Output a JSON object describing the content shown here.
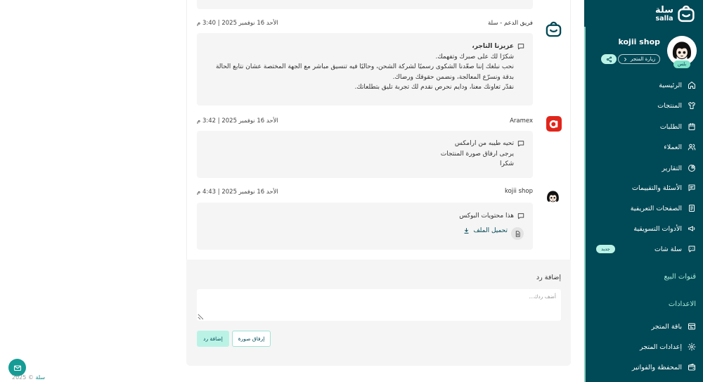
{
  "colors": {
    "primary": "#004956",
    "mint": "#BAF3E6",
    "bubble": "#F5F5F5",
    "aramex": "#E1251B",
    "fab": "#159C95",
    "link": "#0E8A85",
    "plan": "#7EE2C8"
  },
  "sidebar": {
    "logo": {
      "ar": "سلة",
      "en": "salla"
    },
    "store": {
      "name": "kojii shop",
      "plan_badge": "بلس",
      "visit_label": "زيارة المتجر"
    },
    "nav_items": [
      {
        "label": "الرئيسية",
        "icon": "home-icon"
      },
      {
        "label": "المنتجات",
        "icon": "shirt-icon"
      },
      {
        "label": "الطلبات",
        "icon": "orders-icon"
      },
      {
        "label": "العملاء",
        "icon": "users-icon"
      },
      {
        "label": "التقارير",
        "icon": "pie-chart-icon"
      },
      {
        "label": "الأسئلة والتقييمات",
        "icon": "message-square-icon"
      },
      {
        "label": "الصفحات التعريفية",
        "icon": "document-icon"
      },
      {
        "label": "الأدوات التسويقية",
        "icon": "megaphone-icon"
      },
      {
        "label": "سلة شات",
        "icon": "chat-icon",
        "badge": "جديد"
      }
    ],
    "sales_channels_label": "قنوات البيع",
    "settings_label": "الاعدادات",
    "settings_items": [
      {
        "label": "باقة المتجر",
        "icon": "store-plan-icon"
      },
      {
        "label": "إعدادات المتجر",
        "icon": "gear-icon"
      },
      {
        "label": "المحفظة والفواتير",
        "icon": "wallet-icon"
      }
    ]
  },
  "messages": [
    {
      "author": "فريق الدعم - سلة",
      "date": "الأحد 16 نوفمبر 2025 | 3:40 م",
      "greeting": "عزيزنا التاجر،",
      "lines": [
        "شكرًا لك على صبرك وتفهمك.",
        "نحب نبلغك إننا صعّدنا الشكوى رسميًا لشركة الشحن، وحاليًا فيه تنسيق مباشر مع الجهة المختصة عشان نتابع الحالة",
        "بدقة ونسرّع المعالجة، ونضمن حقوقك ورضاك.",
        "نقدّر تعاونك معنا، ودايم نحرص نقدم لك تجربة تليق بتطلعاتك."
      ]
    },
    {
      "author": "Aramex",
      "date": "الأحد 16 نوفمبر 2025 | 3:42 م",
      "lines": [
        "تحيه طيبه من ارامكس",
        "يرجى ارفاق صورة المنتجات",
        "شكرا"
      ]
    },
    {
      "author": "kojii shop",
      "date": "الأحد 16 نوفمبر 2025 | 4:43 م",
      "lines": [
        "هذا محتويات البوكس"
      ],
      "attachment_label": "تحميل الملف"
    }
  ],
  "reply": {
    "label": "إضافة رد",
    "placeholder": "أضف ردك...",
    "attach_button": "إرفاق صورة",
    "submit_button": "إضافة رد"
  },
  "footer": {
    "brand": "سلة",
    "copyright": "© 2025"
  }
}
